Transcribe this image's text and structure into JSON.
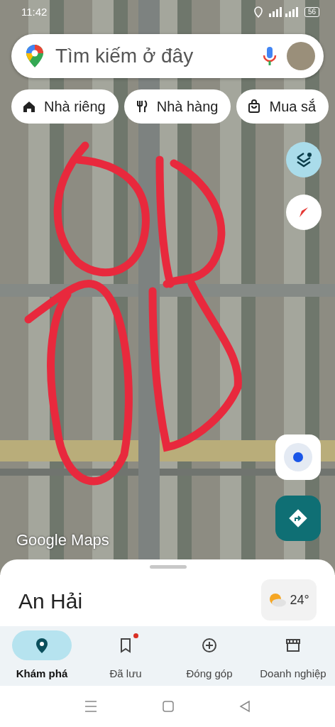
{
  "status_bar": {
    "time": "11:42",
    "battery": "56"
  },
  "search": {
    "placeholder": "Tìm kiếm ở đây"
  },
  "chips": [
    {
      "kind": "home",
      "label": "Nhà riêng"
    },
    {
      "kind": "restaurant",
      "label": "Nhà hàng"
    },
    {
      "kind": "shopping",
      "label": "Mua sắ"
    }
  ],
  "map": {
    "attribution": "Google Maps"
  },
  "sheet": {
    "title": "An Hải",
    "weather": "24°"
  },
  "nav": [
    {
      "kind": "explore",
      "label": "Khám phá",
      "selected": true,
      "notification": false
    },
    {
      "kind": "saved",
      "label": "Đã lưu",
      "selected": false,
      "notification": true
    },
    {
      "kind": "contribute",
      "label": "Đóng góp",
      "selected": false,
      "notification": false
    },
    {
      "kind": "business",
      "label": "Doanh nghiệp",
      "selected": false,
      "notification": false
    }
  ]
}
